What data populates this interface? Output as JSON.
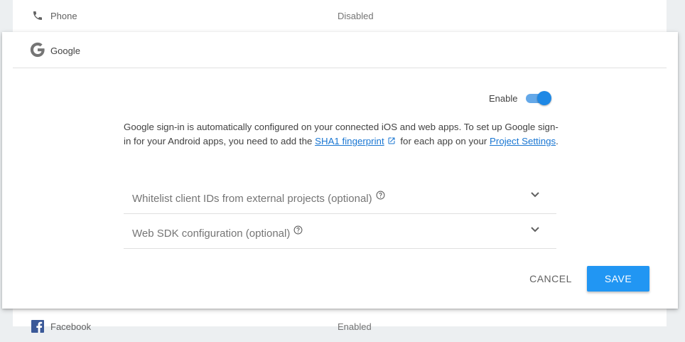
{
  "providers": {
    "phone": {
      "name": "Phone",
      "status": "Disabled",
      "icon": "phone-icon"
    },
    "facebook": {
      "name": "Facebook",
      "status": "Enabled",
      "icon": "facebook-icon"
    }
  },
  "dialog": {
    "title": "Google",
    "icon": "google-icon",
    "enable_label": "Enable",
    "enabled": true,
    "description": {
      "part1": "Google sign-in is automatically configured on your connected iOS and web apps. To set up Google sign-in for your Android apps, you need to add the ",
      "sha1_link": "SHA1 fingerprint",
      "part2": " for each app on your ",
      "settings_link": "Project Settings",
      "part3": "."
    },
    "sections": [
      {
        "label": "Whitelist client IDs from external projects (optional)"
      },
      {
        "label": "Web SDK configuration (optional)"
      }
    ],
    "cancel_label": "CANCEL",
    "save_label": "SAVE"
  },
  "colors": {
    "accent": "#2196f3",
    "link": "#1976d2",
    "toggle_track": "#64a8e8",
    "toggle_thumb": "#1e88e5"
  }
}
